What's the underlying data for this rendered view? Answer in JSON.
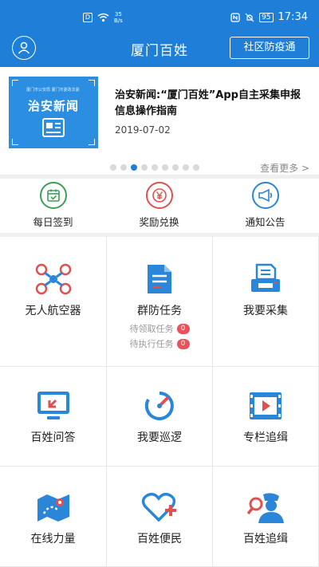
{
  "status_bar": {
    "sim_label": "D",
    "net_speed_value": "35",
    "net_speed_unit": "B/s",
    "battery": "95",
    "time": "17:34",
    "icons": [
      "nfc-icon",
      "mute-icon",
      "wifi-icon"
    ]
  },
  "header": {
    "title": "厦门百姓",
    "right_button": "社区防疫通",
    "colors": {
      "header_bg": "#1f7fd8"
    }
  },
  "news": {
    "thumb_small_text": "厦门市公安局  厦门市委政法委",
    "thumb_title": "治安新闻",
    "title": "治安新闻:“厦门百姓”App自主采集申报信息操作指南",
    "date": "2019-07-02",
    "carousel_total": 9,
    "carousel_active": 3,
    "more_link": "查看更多 >"
  },
  "quick_actions": [
    {
      "label": "每日签到",
      "icon": "calendar-check-icon",
      "color": "#3aa05a"
    },
    {
      "label": "奖励兑换",
      "icon": "yen-coin-icon",
      "color": "#e05050"
    },
    {
      "label": "通知公告",
      "icon": "megaphone-icon",
      "color": "#2a86d8"
    }
  ],
  "grid": [
    {
      "label": "无人航空器",
      "icon": "drone-icon"
    },
    {
      "label": "群防任务",
      "icon": "task-document-icon",
      "tasks": [
        {
          "label": "待领取任务",
          "count": "0"
        },
        {
          "label": "待执行任务",
          "count": "0"
        }
      ]
    },
    {
      "label": "我要采集",
      "icon": "collect-printer-icon"
    },
    {
      "label": "百姓问答",
      "icon": "qa-monitor-icon"
    },
    {
      "label": "我要巡逻",
      "icon": "patrol-compass-icon"
    },
    {
      "label": "专栏追缉",
      "icon": "video-column-icon"
    },
    {
      "label": "在线力量",
      "icon": "map-route-icon"
    },
    {
      "label": "百姓便民",
      "icon": "heart-plus-icon"
    },
    {
      "label": "百姓追缉",
      "icon": "police-search-icon"
    }
  ],
  "colors": {
    "accent_blue": "#2a86d8",
    "accent_red": "#e05050",
    "accent_green": "#3aa05a"
  }
}
